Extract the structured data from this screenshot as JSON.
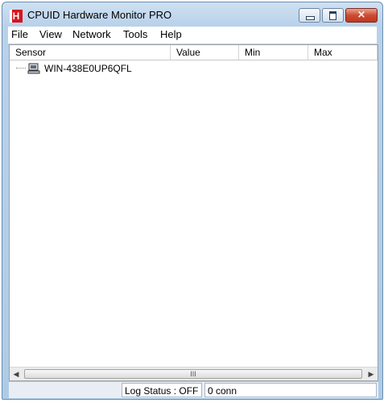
{
  "window": {
    "title": "CPUID Hardware Monitor PRO",
    "app_icon": "cpuid-hwmonitor-icon",
    "app_icon_letter": "H"
  },
  "controls": {
    "minimize": "minimize-icon",
    "maximize": "maximize-icon",
    "close": "×"
  },
  "menu": [
    "File",
    "View",
    "Network",
    "Tools",
    "Help"
  ],
  "columns": [
    "Sensor",
    "Value",
    "Min",
    "Max"
  ],
  "tree": [
    {
      "icon": "computer-icon",
      "label": "WIN-438E0UP6QFL"
    }
  ],
  "scrollbar": {
    "left_arrow": "◀",
    "grip": "III",
    "right_arrow": "▶"
  },
  "status": {
    "log": "Log Status : OFF",
    "connections": "0 conn"
  },
  "colors": {
    "titlebar": "#b9d2ea",
    "close_button": "#c8432b",
    "icon_red": "#d8141b"
  }
}
